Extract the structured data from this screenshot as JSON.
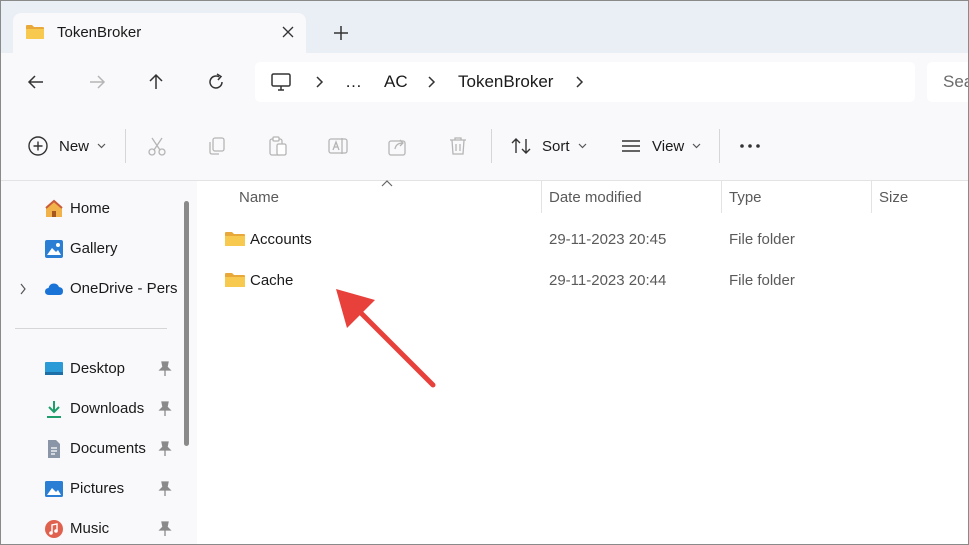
{
  "tab": {
    "title": "TokenBroker"
  },
  "address": {
    "crumbs": [
      "…",
      "AC",
      "TokenBroker"
    ]
  },
  "search": {
    "placeholder": "Sea"
  },
  "toolbar": {
    "new_label": "New",
    "sort_label": "Sort",
    "view_label": "View"
  },
  "sidebar": {
    "items": [
      {
        "label": "Home",
        "icon": "home-icon"
      },
      {
        "label": "Gallery",
        "icon": "gallery-icon"
      },
      {
        "label": "OneDrive - Perso",
        "icon": "cloud-icon"
      },
      {
        "label": "Desktop",
        "icon": "desktop-icon",
        "pinned": true
      },
      {
        "label": "Downloads",
        "icon": "download-icon",
        "pinned": true
      },
      {
        "label": "Documents",
        "icon": "documents-icon",
        "pinned": true
      },
      {
        "label": "Pictures",
        "icon": "pictures-icon",
        "pinned": true
      },
      {
        "label": "Music",
        "icon": "music-icon",
        "pinned": true
      }
    ]
  },
  "columns": {
    "name": "Name",
    "date": "Date modified",
    "type": "Type",
    "size": "Size"
  },
  "files": [
    {
      "name": "Accounts",
      "date": "29-11-2023 20:45",
      "type": "File folder"
    },
    {
      "name": "Cache",
      "date": "29-11-2023 20:44",
      "type": "File folder"
    }
  ],
  "colors": {
    "accent": "#0067c0",
    "folder": "#f4c54a",
    "annotation_arrow": "#e8403a"
  }
}
